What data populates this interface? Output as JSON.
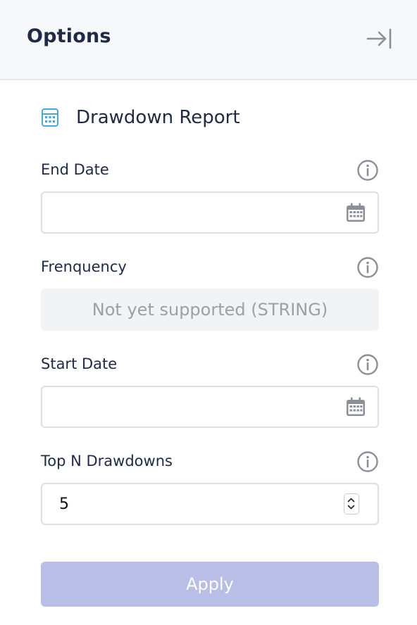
{
  "header": {
    "title": "Options",
    "collapse_icon": "collapse-right-icon"
  },
  "report": {
    "title": "Drawdown Report",
    "icon": "calculator-icon",
    "icon_color": "#4aa8d8"
  },
  "fields": {
    "end_date": {
      "label": "End Date",
      "value": "",
      "icon": "calendar-icon"
    },
    "frequency": {
      "label": "Frenquency",
      "placeholder_text": "Not yet supported (STRING)"
    },
    "start_date": {
      "label": "Start Date",
      "value": "",
      "icon": "calendar-icon"
    },
    "top_n": {
      "label": "Top N Drawdowns",
      "value": "5"
    }
  },
  "apply": {
    "label": "Apply",
    "color": "#b8bee6",
    "enabled": false
  },
  "colors": {
    "text": "#1f2a44",
    "muted_icon": "#8a8f99",
    "header_bg": "#f7f8fa"
  }
}
